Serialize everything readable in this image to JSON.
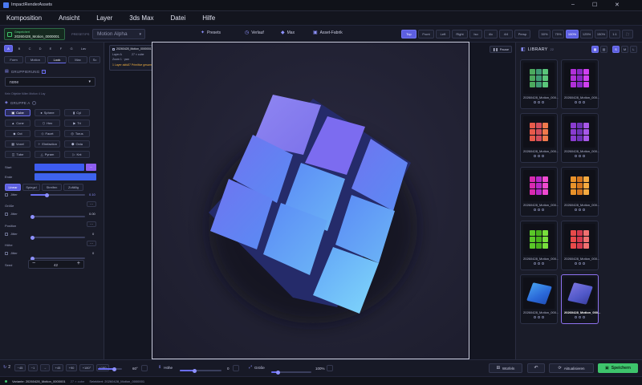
{
  "window": {
    "title": "ImpactRenderAssets",
    "min": "–",
    "max": "☐",
    "close": "✕"
  },
  "menu": [
    "Komposition",
    "Ansicht",
    "Layer",
    "3ds Max",
    "Datei",
    "Hilfe"
  ],
  "toolbar": {
    "status_line": "Gespeichert",
    "comp_name": "20260428_Motion_0000001",
    "preset_label": "PRESET/PS",
    "preset_value": "Motion Alpha",
    "center_tabs": [
      "Presets",
      "Verlauf",
      "Max",
      "Asset-Fabrik"
    ],
    "view_tabs": [
      "Top",
      "Front",
      "Left",
      "Right",
      "Iso",
      "4/c",
      "4/4",
      "Persp"
    ],
    "zoom_tabs": [
      "50%",
      "75%",
      "100%",
      "125%",
      "150%",
      "1:1"
    ]
  },
  "left": {
    "tab_labels": [
      "A",
      "B",
      "C",
      "D",
      "E",
      "F",
      "G",
      "Lav"
    ],
    "subtabs": [
      "Form",
      "Motion",
      "Look",
      "Max",
      "Sc"
    ],
    "gruppierung_label": "GRUPPIERUNG",
    "gruppierung_value": "none",
    "gruppierung_hint": "Kein Objekte füllen Motion 4 Lay",
    "gruppe_label": "GRUPPE A",
    "shapes": [
      "Cube",
      "Sphere",
      "Cyl",
      "Cone",
      "Hex",
      "Tri",
      "Oct",
      "Facet",
      "Torus",
      "Voxel",
      "Elmfaction",
      "Octa",
      "Tube",
      "Pyram",
      "Knt"
    ],
    "active_shape": "Cube",
    "start_label": "Start",
    "ende_label": "Ende",
    "start_color": "#3d5cf0",
    "end_color": "#3e63ec",
    "modes": [
      "Linear",
      "Spiegel",
      "Streifen",
      "Zufällig"
    ],
    "jitter_label": "Jitter",
    "jitter_value": "0.10",
    "groesse_label": "Größe",
    "groesse_value": "0.00",
    "position_label": "Position",
    "position_value": "0",
    "hoehe_label": "Höhe",
    "hoehe_value": "0",
    "seed_label": "Seed",
    "seed_value": "42",
    "minus": "−",
    "plus": "+",
    "dots": "···"
  },
  "canvas": {
    "info_name": "20260428_Motion_0000001",
    "info_layer": "Layer A",
    "info_count": "27 × cube",
    "info_zoom": "Zoom 1 · pan",
    "info_warn_a": "1 Layer aktiv",
    "info_warn_b": "27 Primitive gesamt",
    "pause_label": "Pause",
    "face_colors": {
      "top": "#8a7cf2",
      "front_grad_a": "#5a7cf8",
      "front_grad_b": "#78c6f8"
    }
  },
  "library": {
    "title": "LIBRARY",
    "count": "22",
    "view_buttons": [
      "▦",
      "▤",
      "S",
      "M",
      "L"
    ],
    "items": [
      {
        "name": "20260428_Motion_000...",
        "palette": [
          "#4caa5e",
          "#3f9b74",
          "#5ac67a"
        ]
      },
      {
        "name": "20260428_Motion_000...",
        "palette": [
          "#b030d8",
          "#8a28c6",
          "#d040f0"
        ]
      },
      {
        "name": "20260428_Motion_000...",
        "palette": [
          "#e85a4a",
          "#d44e5c",
          "#f07a4c"
        ]
      },
      {
        "name": "20260428_Motion_000...",
        "palette": [
          "#8a3cd0",
          "#6e34b8",
          "#a858e8"
        ]
      },
      {
        "name": "20260428_Motion_000...",
        "palette": [
          "#d82ab0",
          "#b828c8",
          "#f04ad0"
        ]
      },
      {
        "name": "20260428_Motion_000...",
        "palette": [
          "#e8922a",
          "#d4761e",
          "#f4aa40"
        ]
      },
      {
        "name": "20260428_Motion_000...",
        "palette": [
          "#5ac828",
          "#48b21c",
          "#78e03c"
        ]
      },
      {
        "name": "20260428_Motion_000...",
        "palette": [
          "#e84a4a",
          "#d43a4e",
          "#f07070"
        ]
      },
      {
        "name": "20260428_Motion_000...",
        "palette": [
          "#2a68d8",
          "#2050b8",
          "#46a0f0"
        ]
      },
      {
        "name": "20260428_Motion_000...",
        "palette": [
          "#5058c8",
          "#3c40a0",
          "#7a74e0"
        ]
      }
    ]
  },
  "bottom": {
    "count_a": "2",
    "nav_labels": [
      "−45",
      "−1",
      "→",
      "+45",
      "+90",
      "+180°",
      "+180"
    ],
    "rot_value": "60°",
    "hoehe_label": "Höhe",
    "hoehe_value": "0",
    "groesse_label": "Größe",
    "groesse_value": "100%",
    "wuerfeln_label": "Würfeln",
    "undo_label": "↶",
    "aktualisieren_label": "Aktualisieren",
    "speichern_label": "Speichern"
  },
  "status": {
    "variante": "Variante: 20260428_Motion_0000001",
    "count": "27 × cube",
    "selected": "Selektiert: 20260428_Motion_0000001"
  },
  "colors": {
    "accent": "#6a6df0",
    "save": "#3ec46c"
  }
}
